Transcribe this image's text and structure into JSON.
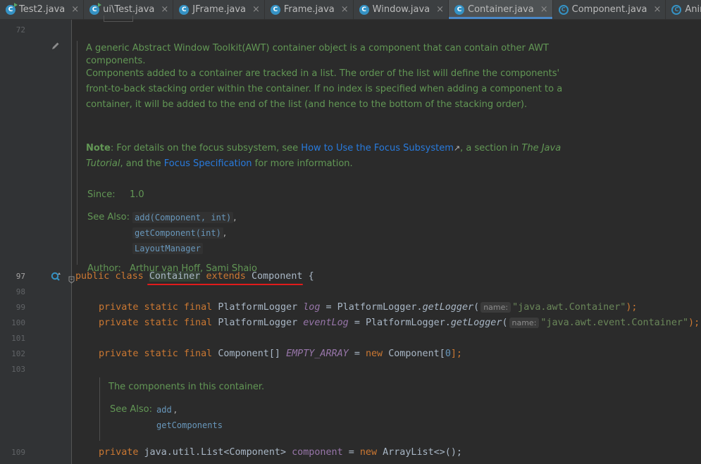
{
  "tabs": [
    {
      "label": "Test2.java",
      "icon": "java-class-run-icon",
      "active": false
    },
    {
      "label": "ui\\Test.java",
      "icon": "java-class-run-icon",
      "active": false
    },
    {
      "label": "JFrame.java",
      "icon": "java-class-icon",
      "active": false
    },
    {
      "label": "Frame.java",
      "icon": "java-class-icon",
      "active": false
    },
    {
      "label": "Window.java",
      "icon": "java-class-icon",
      "active": false
    },
    {
      "label": "Container.java",
      "icon": "java-class-icon",
      "active": true
    },
    {
      "label": "Component.java",
      "icon": "abstract-class-icon",
      "active": false
    },
    {
      "label": "Animal.java",
      "icon": "abstract-class-icon",
      "active": false
    }
  ],
  "tab_close_glyph": "×",
  "icon_letter": "C",
  "line_numbers": {
    "l72": "72",
    "l97": "97",
    "l98": "98",
    "l99": "99",
    "l100": "100",
    "l101": "101",
    "l102": "102",
    "l103": "103",
    "l109": "109"
  },
  "doc1": {
    "p1a": "A generic Abstract Window Toolkit(AWT) container object is a component that can contain other AWT",
    "p1b": "components.",
    "p2a": "Components added to a container are tracked in a list. The order of the list will define the components'",
    "p2b": "front-to-back stacking order within the container. If no index is specified when adding a component to a",
    "p2c": "container, it will be added to the end of the list (and hence to the bottom of the stacking order).",
    "note_label": "Note",
    "note_a": ": For details on the focus subsystem, see ",
    "note_link1": "How to Use the Focus Subsystem",
    "note_arrow": "↗",
    "note_b": ", a section in ",
    "note_tutorial": "The Java",
    "note_tutorial2": "Tutorial",
    "note_c": ", and the ",
    "note_link2": "Focus Specification",
    "note_d": " for more information.",
    "since_label": "Since:",
    "since_value": "1.0",
    "see_also_label": "See Also:",
    "see_also": [
      "add(Component, int)",
      "getComponent(int)",
      "LayoutManager"
    ],
    "see_sep": ",",
    "author_label": "Author:",
    "author_value": "Arthur van Hoff, Sami Shaio"
  },
  "code": {
    "l97": {
      "public": "public",
      "class": "class",
      "name": "Container",
      "extends": "extends",
      "parent": "Component",
      "brace": "{"
    },
    "l99": {
      "mods": "private static final",
      "type": "PlatformLogger",
      "var": "log",
      "eq": "=",
      "cls": "PlatformLogger.",
      "method": "getLogger",
      "open": "(",
      "hint": "name:",
      "str": "\"java.awt.Container\"",
      "close": ");"
    },
    "l100": {
      "mods": "private static final",
      "type": "PlatformLogger",
      "var": "eventLog",
      "eq": "=",
      "cls": "PlatformLogger.",
      "method": "getLogger",
      "open": "(",
      "hint": "name:",
      "str": "\"java.awt.event.Container\"",
      "close": ");"
    },
    "l102": {
      "mods": "private static final",
      "type": "Component[]",
      "var": "EMPTY_ARRAY",
      "eq": "=",
      "new": "new",
      "cls": "Component[",
      "num": "0",
      "close": "];"
    },
    "l109": {
      "mods": "private",
      "type": "java.util.List<Component>",
      "var": "component",
      "eq": "=",
      "new": "new",
      "rest": "ArrayList<>();"
    }
  },
  "doc2": {
    "text": "The components in this container.",
    "see_also_label": "See Also:",
    "see_also": [
      "add",
      "getComponents"
    ],
    "see_sep": ","
  },
  "colors": {
    "background": "#2b2b2b",
    "gutter": "#313335",
    "doc_text": "#629755",
    "keyword": "#cc7832",
    "link": "#287bde",
    "active_tab_underline": "#4a88c7",
    "string": "#6a8759",
    "field": "#9876aa",
    "underline_annotation": "#e01b1b"
  }
}
